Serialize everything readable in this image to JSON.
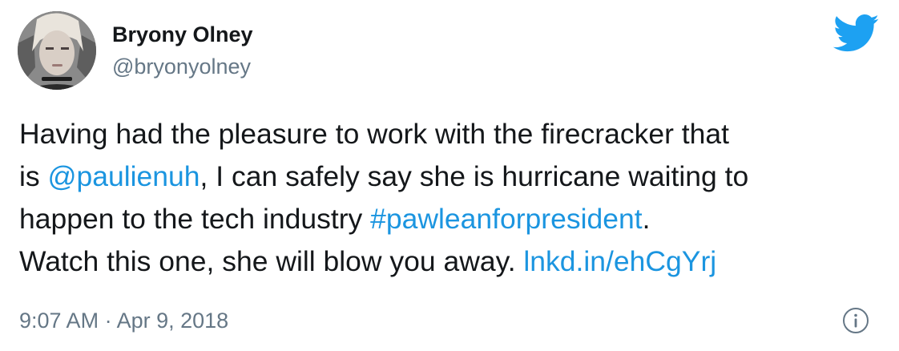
{
  "author": {
    "display_name": "Bryony Olney",
    "handle": "@bryonyolney"
  },
  "tweet": {
    "line1": {
      "text": "Having had the pleasure to work with the firecracker that"
    },
    "line2": {
      "prefix": "is ",
      "mention": "@paulienuh",
      "suffix": ", I can safely say she is hurricane waiting to"
    },
    "line3": {
      "prefix": "happen to the tech industry ",
      "hashtag": "#pawleanforpresident",
      "suffix": "."
    },
    "line4": {
      "prefix": "Watch this one, she will blow you away. ",
      "link": "lnkd.in/ehCgYrj"
    }
  },
  "meta": {
    "time": "9:07 AM",
    "separator": " · ",
    "date": "Apr 9, 2018"
  },
  "icons": {
    "brand": "twitter-bird-icon",
    "info": "info-icon"
  },
  "colors": {
    "text": "#14171a",
    "secondary": "#657786",
    "link": "#1b95e0",
    "brand": "#1da1f2"
  }
}
